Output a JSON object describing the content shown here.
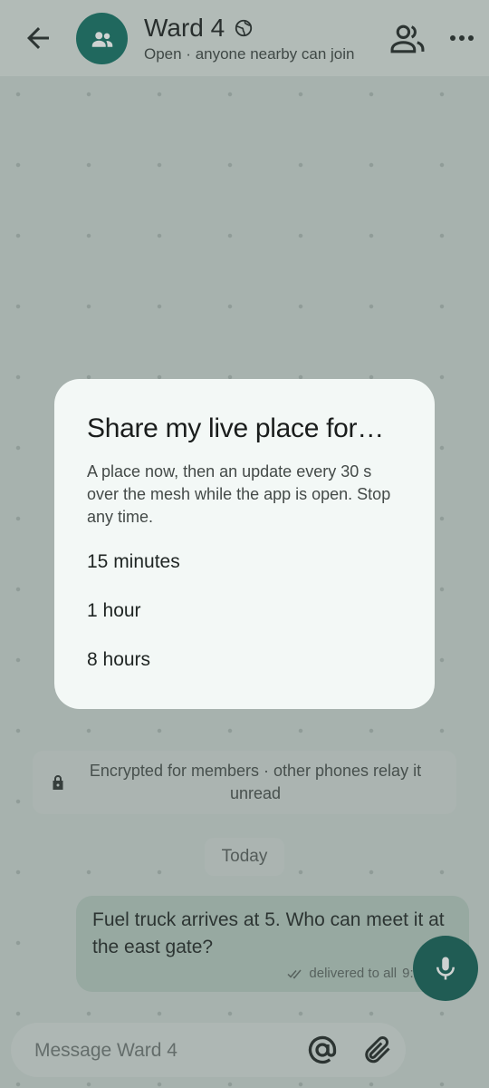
{
  "header": {
    "back_icon": "arrow-left-icon",
    "group_avatar_icon": "group-icon",
    "title": "Ward 4",
    "title_badge_icon": "globe-icon",
    "subtitle": "Open · anyone nearby can join",
    "members_icon": "people-icon",
    "more_icon": "more-horizontal-icon"
  },
  "chat": {
    "encryption_note": "Encrypted for members · other phones relay it unread",
    "date_chip": "Today",
    "messages": [
      {
        "text": "Fuel truck arrives at 5. Who can meet it at the east gate?",
        "status": "delivered to all",
        "time": "9:26 PM"
      }
    ]
  },
  "composer": {
    "placeholder": "Message Ward 4"
  },
  "dialog": {
    "title": "Share my live place for…",
    "body": "A place now, then an update every 30 s over the mesh while the app is open. Stop any time.",
    "options": [
      "15 minutes",
      "1 hour",
      "8 hours"
    ]
  },
  "colors": {
    "accent": "#0e6d60",
    "mic_button": "#0e5c52",
    "outgoing_bubble": "#b3c6bd",
    "dialog_bg": "#f3f8f6"
  }
}
